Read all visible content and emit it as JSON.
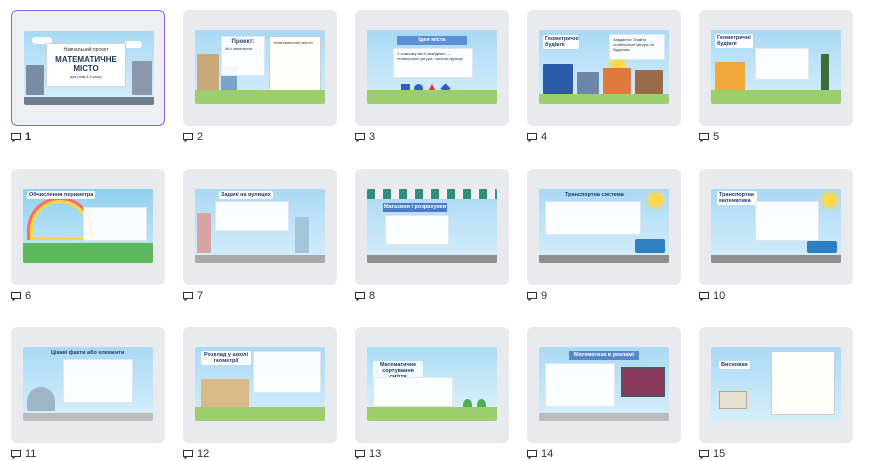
{
  "slides": [
    {
      "number": "1",
      "title": "Навчальний проект",
      "subtitle": "МАТЕМАТИЧНЕ МІСТО",
      "note": "для учнів 4-А класу"
    },
    {
      "number": "2",
      "title": "Проект:",
      "subtitle": "Мої запитання",
      "note": "«Математичне місто»"
    },
    {
      "number": "3",
      "title": "Ідея міста",
      "subtitle": "",
      "note": "У кожному місті знайдемо — геометричні фігури, числові функції"
    },
    {
      "number": "4",
      "title": "Геометричні будівлі",
      "subtitle": "",
      "note": "Завдання: Знайти геометричні фігури на будинках"
    },
    {
      "number": "5",
      "title": "Геометричні будівлі",
      "subtitle": "",
      "note": ""
    },
    {
      "number": "6",
      "title": "Обчислення периметра",
      "subtitle": "",
      "note": ""
    },
    {
      "number": "7",
      "title": "Задачі на вулицях",
      "subtitle": "",
      "note": ""
    },
    {
      "number": "8",
      "title": "Магазини і розрахунки",
      "subtitle": "",
      "note": ""
    },
    {
      "number": "9",
      "title": "Транспортна система",
      "subtitle": "",
      "note": ""
    },
    {
      "number": "10",
      "title": "Транспортна математика",
      "subtitle": "",
      "note": ""
    },
    {
      "number": "11",
      "title": "Цікаві факти або елементи",
      "subtitle": "",
      "note": ""
    },
    {
      "number": "12",
      "title": "Розклад у школі",
      "subtitle": "геометрії",
      "note": ""
    },
    {
      "number": "13",
      "title": "Математичне сортування",
      "subtitle": "сміття",
      "note": ""
    },
    {
      "number": "14",
      "title": "Математика в рекламі",
      "subtitle": "",
      "note": ""
    },
    {
      "number": "15",
      "title": "Висновки",
      "subtitle": "",
      "note": ""
    }
  ],
  "colors": {
    "accent": "#8b5cf6",
    "card_bg": "#e9eaee"
  },
  "icons": {
    "slide_comment": "comment-slide-icon"
  }
}
